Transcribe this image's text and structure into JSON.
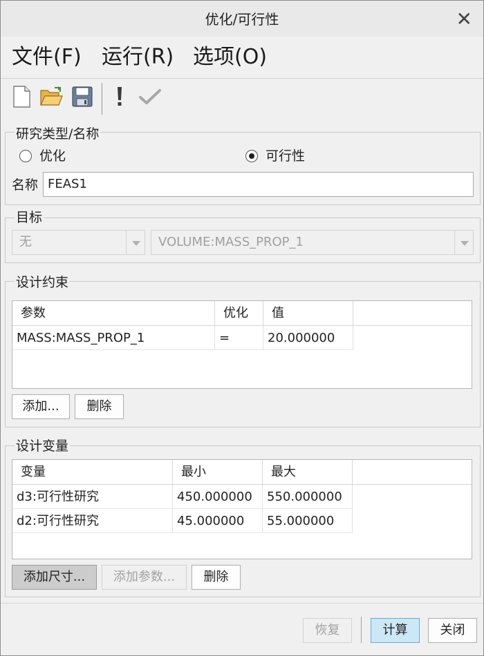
{
  "window": {
    "title": "优化/可行性",
    "close_symbol": "✕"
  },
  "menu": [
    "文件(F)",
    "运行(R)",
    "选项(O)"
  ],
  "toolbar": {
    "icons": [
      "new-file-icon",
      "open-folder-icon",
      "save-icon",
      "run-icon",
      "check-icon"
    ]
  },
  "study": {
    "group_label": "研究类型/名称",
    "options": [
      {
        "label": "优化",
        "selected": false
      },
      {
        "label": "可行性",
        "selected": true
      }
    ],
    "name_label": "名称",
    "name_value": "FEAS1"
  },
  "goal": {
    "group_label": "目标",
    "combo1": "无",
    "combo2": "VOLUME:MASS_PROP_1"
  },
  "constraints": {
    "group_label": "设计约束",
    "columns": [
      "参数",
      "优化",
      "值"
    ],
    "rows": [
      [
        "MASS:MASS_PROP_1",
        "=",
        "20.000000"
      ]
    ],
    "add_label": "添加...",
    "delete_label": "删除"
  },
  "variables": {
    "group_label": "设计变量",
    "columns": [
      "变量",
      "最小",
      "最大"
    ],
    "rows": [
      [
        "d3:可行性研究",
        "450.000000",
        "550.000000"
      ],
      [
        "d2:可行性研究",
        "45.000000",
        "55.000000"
      ]
    ],
    "add_dim_label": "添加尺寸...",
    "add_param_label": "添加参数...",
    "delete_label": "删除"
  },
  "footer": {
    "restore_label": "恢复",
    "compute_label": "计算",
    "close_label": "关闭"
  },
  "colors": {
    "primary_button_bg": "#cce8f7",
    "primary_button_border": "#5aaede",
    "pressed_button_bg": "#cccccc"
  }
}
